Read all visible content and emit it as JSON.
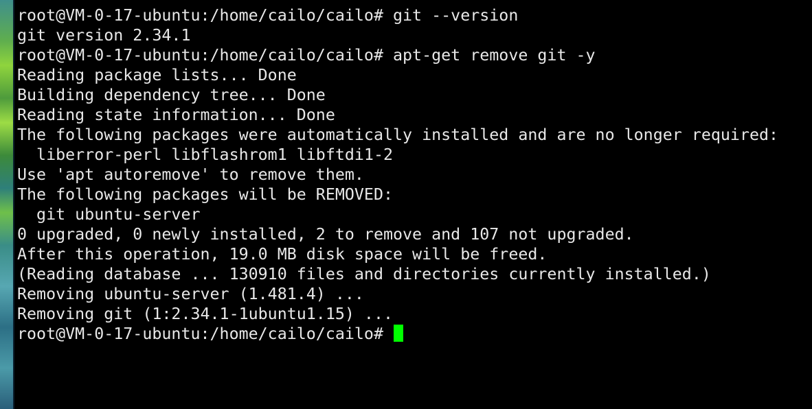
{
  "terminal": {
    "lines": [
      "root@VM-0-17-ubuntu:/home/cailo/cailo# git --version",
      "git version 2.34.1",
      "root@VM-0-17-ubuntu:/home/cailo/cailo# apt-get remove git -y",
      "Reading package lists... Done",
      "Building dependency tree... Done",
      "Reading state information... Done",
      "The following packages were automatically installed and are no longer required:",
      "  liberror-perl libflashrom1 libftdi1-2",
      "Use 'apt autoremove' to remove them.",
      "The following packages will be REMOVED:",
      "  git ubuntu-server",
      "0 upgraded, 0 newly installed, 2 to remove and 107 not upgraded.",
      "After this operation, 19.0 MB disk space will be freed.",
      "(Reading database ... 130910 files and directories currently installed.)",
      "Removing ubuntu-server (1.481.4) ...",
      "Removing git (1:2.34.1-1ubuntu1.15) ..."
    ],
    "prompt": "root@VM-0-17-ubuntu:/home/cailo/cailo# ",
    "cursor_color": "#00ff00",
    "text_color": "#e8e8e8",
    "background_color": "#000000"
  }
}
